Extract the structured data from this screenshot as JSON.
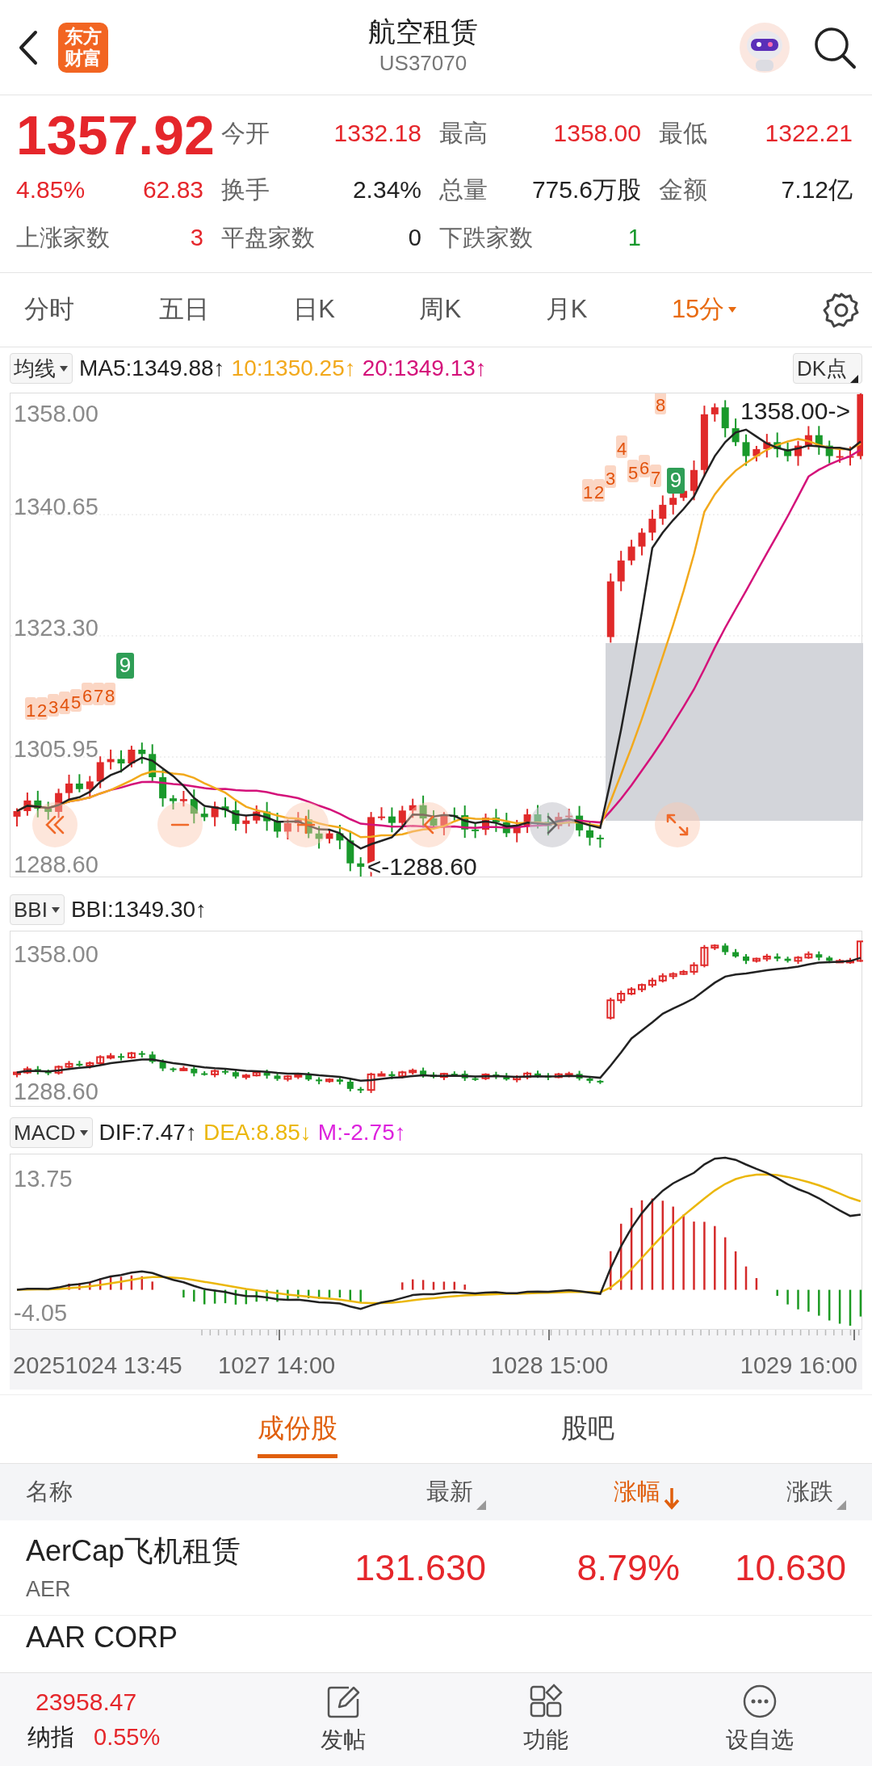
{
  "header": {
    "logo": "东方财富",
    "title": "航空租赁",
    "code": "US37070"
  },
  "quote": {
    "price": "1357.92",
    "change_pct": "4.85%",
    "change": "62.83",
    "stats": [
      {
        "label": "今开",
        "value": "1332.18",
        "color": "#e5262b"
      },
      {
        "label": "最高",
        "value": "1358.00",
        "color": "#e5262b"
      },
      {
        "label": "最低",
        "value": "1322.21",
        "color": "#e5262b"
      },
      {
        "label": "换手",
        "value": "2.34%",
        "color": "#222222"
      },
      {
        "label": "总量",
        "value": "775.6万股",
        "color": "#222222"
      },
      {
        "label": "金额",
        "value": "7.12亿",
        "color": "#222222"
      }
    ],
    "breadth": [
      {
        "label": "上涨家数",
        "value": "3",
        "color": "#e5262b"
      },
      {
        "label": "平盘家数",
        "value": "0",
        "color": "#222222"
      },
      {
        "label": "下跌家数",
        "value": "1",
        "color": "#17982c"
      }
    ]
  },
  "periods": [
    {
      "label": "分时",
      "selected": false
    },
    {
      "label": "五日",
      "selected": false
    },
    {
      "label": "日K",
      "selected": false
    },
    {
      "label": "周K",
      "selected": false
    },
    {
      "label": "月K",
      "selected": false
    },
    {
      "label": "15分",
      "selected": true
    }
  ],
  "main_chart": {
    "indicator": "均线",
    "mode_button": "DK点",
    "legend": [
      {
        "text": "MA5:1349.88↑",
        "color": "#222222"
      },
      {
        "text": "10:1350.25↑",
        "color": "#f2a91c"
      },
      {
        "text": "20:1349.13↑",
        "color": "#d4127a"
      }
    ],
    "y_labels": [
      "1358.00",
      "1340.65",
      "1323.30",
      "1305.95",
      "1288.60"
    ],
    "high_label": "1358.00->",
    "low_label": "<-1288.60",
    "markers": [
      {
        "text": "1",
        "kind": "count"
      },
      {
        "text": "2",
        "kind": "count"
      },
      {
        "text": "3",
        "kind": "count"
      },
      {
        "text": "4",
        "kind": "count"
      },
      {
        "text": "5",
        "kind": "count"
      },
      {
        "text": "6",
        "kind": "count"
      },
      {
        "text": "7",
        "kind": "count"
      },
      {
        "text": "8",
        "kind": "count"
      },
      {
        "text": "9",
        "kind": "signal"
      },
      {
        "text": "1",
        "kind": "count"
      },
      {
        "text": "2",
        "kind": "count"
      },
      {
        "text": "3",
        "kind": "count"
      },
      {
        "text": "4",
        "kind": "count"
      },
      {
        "text": "5",
        "kind": "count"
      },
      {
        "text": "6",
        "kind": "count"
      },
      {
        "text": "7",
        "kind": "count"
      },
      {
        "text": "8",
        "kind": "count"
      },
      {
        "text": "9",
        "kind": "signal"
      }
    ],
    "nav_buttons": [
      {
        "kind": "rewind",
        "disabled": false
      },
      {
        "kind": "minus",
        "disabled": false
      },
      {
        "kind": "plus",
        "disabled": false
      },
      {
        "kind": "prev",
        "disabled": false
      },
      {
        "kind": "next",
        "disabled": true
      },
      {
        "kind": "expand",
        "disabled": false
      }
    ]
  },
  "bbi": {
    "indicator": "BBI",
    "legend": [
      {
        "text": "BBI:1349.30↑",
        "color": "#222222"
      }
    ],
    "y_labels": [
      "1358.00",
      "1288.60"
    ]
  },
  "macd": {
    "indicator": "MACD",
    "legend": [
      {
        "text": "DIF:7.47↑",
        "color": "#222222"
      },
      {
        "text": "DEA:8.85↓",
        "color": "#ebb70c"
      },
      {
        "text": "M:-2.75↑",
        "color": "#dd22dd"
      }
    ],
    "y_labels": [
      "13.75",
      "-4.05"
    ]
  },
  "time_axis": [
    "20251024 13:45",
    "1027 14:00",
    "1028 15:00",
    "1029 16:00"
  ],
  "list_tabs": [
    {
      "label": "成份股",
      "selected": true
    },
    {
      "label": "股吧",
      "selected": false
    }
  ],
  "table": {
    "columns": [
      {
        "label": "名称",
        "kind": "plain"
      },
      {
        "label": "最新",
        "kind": "sortable"
      },
      {
        "label": "涨幅",
        "kind": "sorted-desc"
      },
      {
        "label": "涨跌",
        "kind": "sortable"
      }
    ],
    "rows": [
      {
        "name": "AerCap飞机租赁",
        "symbol": "AER",
        "price": "131.630",
        "change_pct": "8.79%",
        "change": "10.630"
      },
      {
        "name": "AAR CORP"
      }
    ]
  },
  "bottom_bar": {
    "index_value": "23958.47",
    "index_name": "纳指",
    "index_change": "0.55%",
    "actions": [
      {
        "label": "发帖",
        "kind": "compose"
      },
      {
        "label": "功能",
        "kind": "apps"
      },
      {
        "label": "设自选",
        "kind": "more"
      }
    ]
  }
}
